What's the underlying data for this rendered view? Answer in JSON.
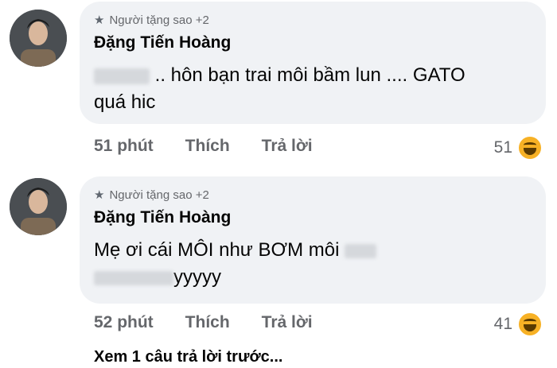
{
  "comments": [
    {
      "badge": "Người tặng sao +2",
      "author": "Đặng Tiến Hoàng",
      "text_line1": ".. hôn bạn trai môi bầm lun .... GATO",
      "text_line2": "quá hic",
      "time": "51 phút",
      "like": "Thích",
      "reply": "Trả lời",
      "reaction_count": "51",
      "reaction_icon": "haha-emoji"
    },
    {
      "badge": "Người tặng sao +2",
      "author": "Đặng Tiến Hoàng",
      "text_line1": "Mẹ ơi cái MÔI như BƠM môi",
      "text_line2": "yyyyy",
      "time": "52 phút",
      "like": "Thích",
      "reply": "Trả lời",
      "reaction_count": "41",
      "reaction_icon": "haha-emoji"
    }
  ],
  "view_more": "Xem 1 câu trả lời trước..."
}
